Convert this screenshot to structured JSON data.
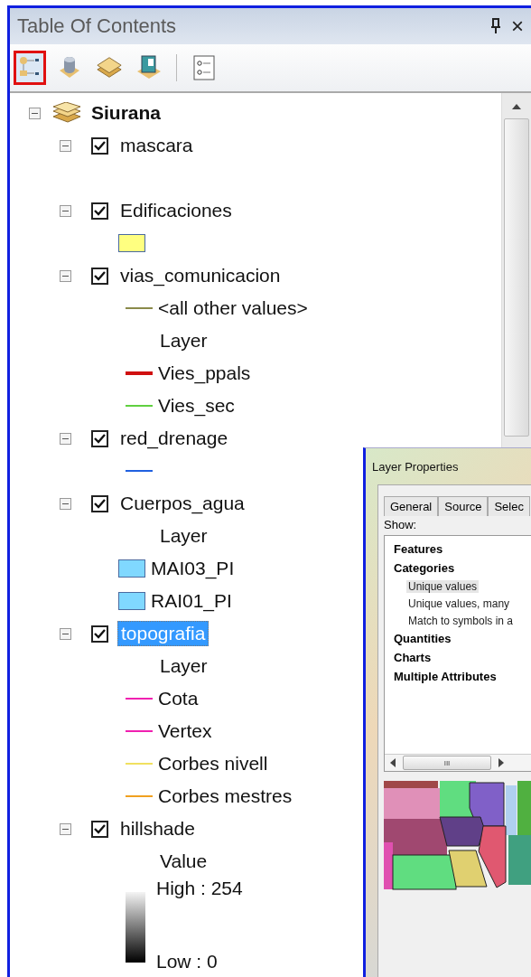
{
  "panel": {
    "title": "Table Of Contents",
    "close": "×"
  },
  "toolbar": [
    {
      "selected": true
    },
    {
      "selected": false
    },
    {
      "selected": false
    },
    {
      "selected": false
    },
    {
      "selected": false
    }
  ],
  "group": {
    "name": "Siurana",
    "expanded": true
  },
  "layers": [
    {
      "name": "mascara",
      "checked": true,
      "expanded": true,
      "selected": false,
      "legend": [
        {
          "kind": "hollow"
        }
      ]
    },
    {
      "name": "Edificaciones",
      "checked": true,
      "expanded": true,
      "selected": false,
      "legend": [
        {
          "kind": "fill",
          "color": "#ffff80"
        }
      ]
    },
    {
      "name": "vias_comunicacion",
      "checked": true,
      "expanded": true,
      "selected": false,
      "legend": [
        {
          "kind": "line",
          "color": "#8a8a4a",
          "label": "<all other values>"
        },
        {
          "kind": "heading",
          "label": "Layer"
        },
        {
          "kind": "line",
          "color": "#d01010",
          "label": "Vies_ppals",
          "thick": true
        },
        {
          "kind": "line",
          "color": "#60d040",
          "label": "Vies_sec"
        }
      ]
    },
    {
      "name": "red_drenage",
      "checked": true,
      "expanded": true,
      "selected": false,
      "legend": [
        {
          "kind": "line",
          "color": "#2060e0"
        }
      ]
    },
    {
      "name": "Cuerpos_agua",
      "checked": true,
      "expanded": true,
      "selected": false,
      "legend": [
        {
          "kind": "heading",
          "label": "Layer"
        },
        {
          "kind": "fill",
          "color": "#80d8ff",
          "label": "MAI03_PI"
        },
        {
          "kind": "fill",
          "color": "#80d8ff",
          "label": "RAI01_PI"
        }
      ]
    },
    {
      "name": "topografia",
      "checked": true,
      "expanded": true,
      "selected": true,
      "legend": [
        {
          "kind": "heading",
          "label": "Layer"
        },
        {
          "kind": "line",
          "color": "#f020b0",
          "label": "Cota"
        },
        {
          "kind": "line",
          "color": "#f020b0",
          "label": "Vertex"
        },
        {
          "kind": "line",
          "color": "#f0e060",
          "label": "Corbes nivell"
        },
        {
          "kind": "line",
          "color": "#f0a020",
          "label": "Corbes mestres"
        }
      ]
    },
    {
      "name": "hillshade",
      "checked": true,
      "expanded": true,
      "selected": false,
      "legend": [
        {
          "kind": "heading",
          "label": "Value"
        },
        {
          "kind": "ramp",
          "high": "High : 254",
          "low": "Low : 0"
        }
      ]
    }
  ],
  "dialog": {
    "title": "Layer Properties",
    "tabs": [
      {
        "label": "General",
        "selected": false
      },
      {
        "label": "Source",
        "selected": false
      },
      {
        "label": "Selec",
        "selected": false
      }
    ],
    "show_label": "Show:",
    "renderers": [
      {
        "label": "Features",
        "selected": false
      },
      {
        "label": "Categories",
        "selected": false,
        "children": [
          {
            "label": "Unique values",
            "selected": true
          },
          {
            "label": "Unique values, many",
            "selected": false
          },
          {
            "label": "Match to symbols in a",
            "selected": false
          }
        ]
      },
      {
        "label": "Quantities",
        "selected": false
      },
      {
        "label": "Charts",
        "selected": false
      },
      {
        "label": "Multiple Attributes",
        "selected": false
      }
    ],
    "scroll_grip": "III"
  }
}
